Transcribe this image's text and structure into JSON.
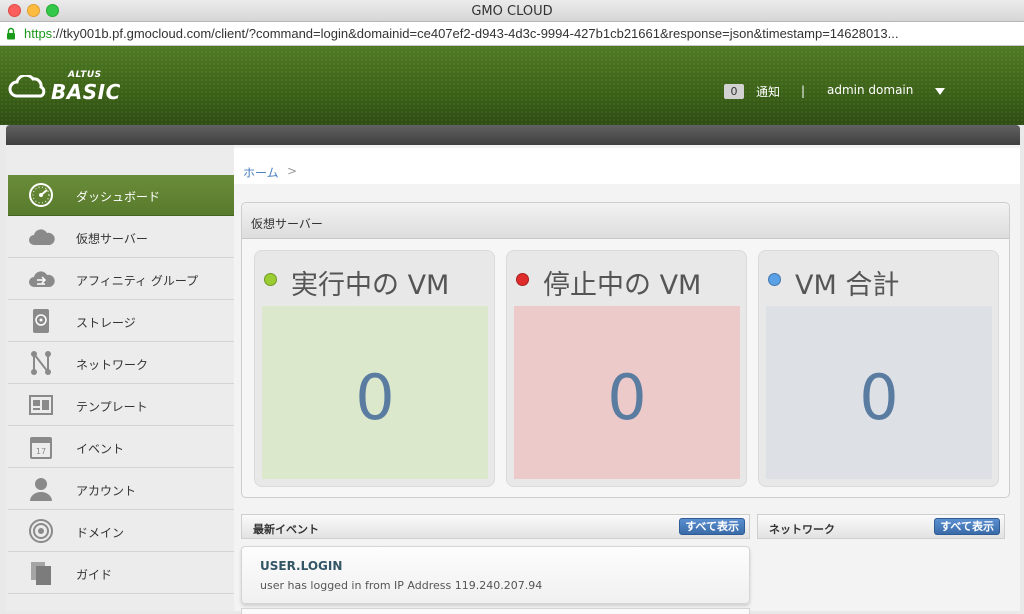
{
  "window": {
    "title": "GMO CLOUD"
  },
  "browser": {
    "url_scheme": "https",
    "url_rest": "://tky001b.pf.gmocloud.com/client/?command=login&domainid=ce407ef2-d943-4d3c-9994-427b1cb21661&response=json&timestamp=14628013..."
  },
  "header": {
    "logo_top": "ALTUS",
    "logo_main": "BASIC",
    "notification_count": "0",
    "notification_label": "通知",
    "separator": "|",
    "account_name": "admin domain"
  },
  "sidebar": {
    "items": [
      {
        "label": "ダッシュボード",
        "icon": "dashboard-gauge-icon",
        "active": true
      },
      {
        "label": "仮想サーバー",
        "icon": "cloud-icon"
      },
      {
        "label": "アフィニティ グループ",
        "icon": "cloud-group-icon"
      },
      {
        "label": "ストレージ",
        "icon": "hard-disk-icon"
      },
      {
        "label": "ネットワーク",
        "icon": "network-icon"
      },
      {
        "label": "テンプレート",
        "icon": "template-icon"
      },
      {
        "label": "イベント",
        "icon": "calendar-icon"
      },
      {
        "label": "アカウント",
        "icon": "user-icon"
      },
      {
        "label": "ドメイン",
        "icon": "domain-target-icon"
      },
      {
        "label": "ガイド",
        "icon": "guide-icon"
      }
    ]
  },
  "breadcrumb": {
    "home": "ホーム",
    "separator": ">"
  },
  "vserver_panel": {
    "title": "仮想サーバー",
    "cards": [
      {
        "title": "実行中の VM",
        "value": "0",
        "dot_color": "#9acd32",
        "box_color": "#dce8cc"
      },
      {
        "title": "停止中の VM",
        "value": "0",
        "dot_color": "#e02b2b",
        "box_color": "#eccaca"
      },
      {
        "title": "VM 合計",
        "value": "0",
        "dot_color": "#5aa0e6",
        "box_color": "#dde1e6"
      }
    ]
  },
  "events_section": {
    "title": "最新イベント",
    "button": "すべて表示"
  },
  "network_section": {
    "title": "ネットワーク",
    "button": "すべて表示"
  },
  "events": [
    {
      "title": "USER.LOGIN",
      "description": "user has logged in from IP Address 119.240.207.94"
    }
  ],
  "colors": {
    "header_green": "#3b6117",
    "active_nav": "#5f832f",
    "button_blue": "#3a6ba8"
  }
}
